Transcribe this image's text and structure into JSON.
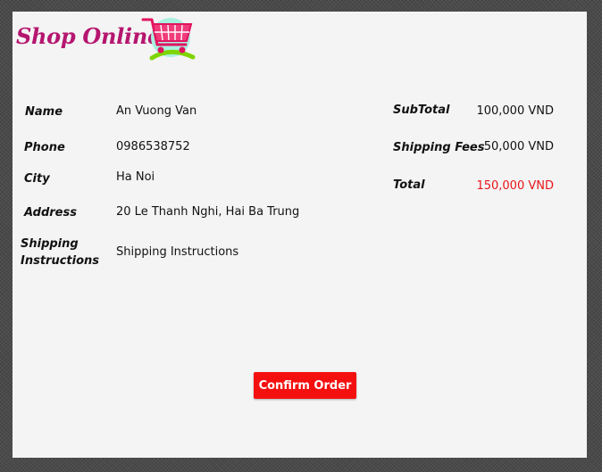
{
  "header": {
    "logo_text": "Shop Online",
    "logo_icon": "shopping-cart-icon"
  },
  "customer": {
    "fields": [
      {
        "label": "Name",
        "value": "An Vuong Van"
      },
      {
        "label": "Phone",
        "value": "0986538752"
      },
      {
        "label": "City",
        "value": "Ha Noi"
      },
      {
        "label": "Address",
        "value": "20 Le Thanh Nghi, Hai Ba Trung"
      },
      {
        "label": "Shipping Instructions",
        "value": "Shipping Instructions"
      }
    ]
  },
  "summary": {
    "subtotal_label": "SubTotal",
    "subtotal_value": "100,000 VND",
    "shipping_label": "Shipping Fees",
    "shipping_value": "50,000 VND",
    "total_label": "Total",
    "total_value": "150,000 VND"
  },
  "actions": {
    "confirm_label": "Confirm Order"
  },
  "colors": {
    "brand": "#b5166f",
    "accent": "#f51010",
    "total_text": "#e8141b",
    "panel_background": "#f4f4f4"
  }
}
